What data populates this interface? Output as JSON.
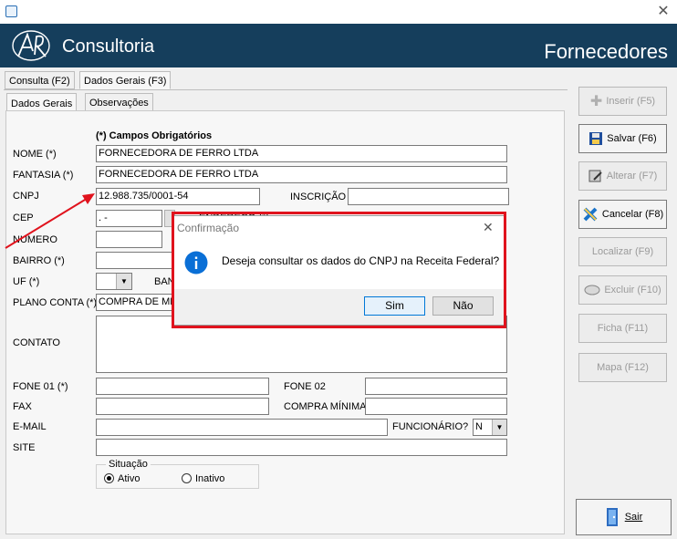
{
  "window": {
    "close_glyph": "✕"
  },
  "header": {
    "brand": "Consultoria",
    "title": "Fornecedores"
  },
  "tabs": [
    {
      "label": "Consulta (F2)"
    },
    {
      "label": "Dados Gerais (F3)"
    }
  ],
  "subtabs": [
    {
      "label": "Dados Gerais"
    },
    {
      "label": "Observações"
    }
  ],
  "form": {
    "required_note": "(*) Campos Obrigatórios",
    "nome": {
      "label": "NOME (*)",
      "value": "FORNECEDORA DE FERRO LTDA"
    },
    "fantasia": {
      "label": "FANTASIA (*)",
      "value": "FORNECEDORA DE FERRO LTDA"
    },
    "cnpj": {
      "label": "CNPJ",
      "value": "12.988.735/0001-54"
    },
    "inscricao": {
      "label": "INSCRIÇÃO",
      "value": ""
    },
    "cep": {
      "label": "CEP",
      "value": ".   -"
    },
    "endereco": {
      "label": "ENDEREÇO (*)"
    },
    "numero": {
      "label": "NUMERO",
      "value": ""
    },
    "bairro": {
      "label": "BAIRRO (*)",
      "value": ""
    },
    "uf": {
      "label": "UF (*)",
      "value": ""
    },
    "banco_label_fragment": "BAN",
    "plano_conta": {
      "label": "PLANO CONTA (*)",
      "value": "COMPRA DE ME"
    },
    "contato": {
      "label": "CONTATO",
      "value": ""
    },
    "fone01": {
      "label": "FONE 01 (*)",
      "value": ""
    },
    "fone02": {
      "label": "FONE 02",
      "value": ""
    },
    "fax": {
      "label": "FAX",
      "value": ""
    },
    "compra_minima": {
      "label": "COMPRA MÍNIMA",
      "value": ""
    },
    "email": {
      "label": "E-MAIL",
      "value": ""
    },
    "funcionario": {
      "label": "FUNCIONÁRIO?",
      "value": "N"
    },
    "site": {
      "label": "SITE",
      "value": ""
    },
    "situacao": {
      "legend": "Situação",
      "options": [
        "Ativo",
        "Inativo"
      ],
      "selected": "Ativo"
    }
  },
  "side_buttons": [
    {
      "label": "Inserir (F5)",
      "enabled": false,
      "icon": "plus-icon"
    },
    {
      "label": "Salvar (F6)",
      "enabled": true,
      "icon": "save-icon"
    },
    {
      "label": "Alterar (F7)",
      "enabled": false,
      "icon": "edit-icon"
    },
    {
      "label": "Cancelar (F8)",
      "enabled": true,
      "icon": "cancel-icon"
    },
    {
      "label": "Localizar (F9)",
      "enabled": false
    },
    {
      "label": "Excluir (F10)",
      "enabled": false,
      "icon": "eraser-icon"
    },
    {
      "label": "Ficha (F11)",
      "enabled": false
    },
    {
      "label": "Mapa (F12)",
      "enabled": false
    },
    {
      "label": "Sair",
      "enabled": true,
      "icon": "exit-door-icon"
    }
  ],
  "dialog": {
    "title": "Confirmação",
    "message": "Deseja consultar os dados do CNPJ na Receita Federal?",
    "yes": "Sim",
    "no": "Não",
    "close_glyph": "✕",
    "icon": "info-icon"
  },
  "colors": {
    "header_bg": "#153e5c",
    "highlight": "#e0131d",
    "info_blue": "#0a6fd6"
  }
}
